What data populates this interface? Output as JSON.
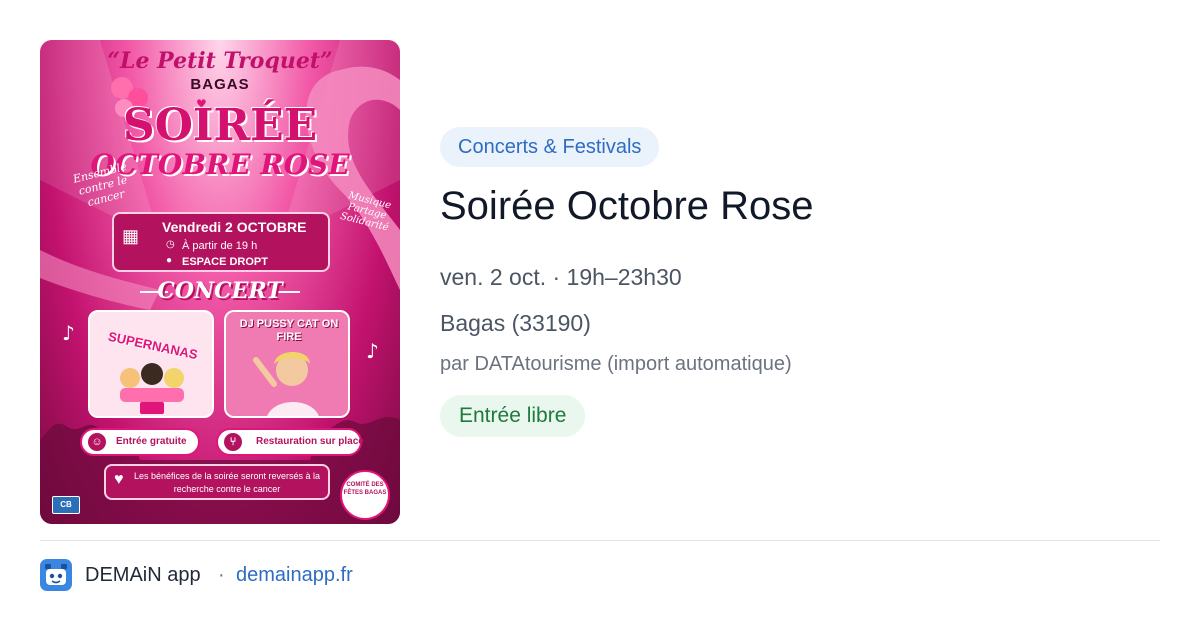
{
  "poster": {
    "brand": "“Le Petit Troquet”",
    "town": "BAGAS",
    "headline": "SOIRÉE",
    "subheadline": "OCTOBRE ROSE",
    "side_left": "Ensemble contre le cancer",
    "side_right": "Musique Partage Solidarité",
    "date": "Vendredi 2 OCTOBRE",
    "time": "À partir de 19 h",
    "venue": "ESPACE DROPT",
    "concert": "CONCERT",
    "act1": "SUPERNANAS",
    "act2": "DJ PUSSY CAT ON FIRE",
    "perk1": "Entrée gratuite",
    "perk2": "Restauration sur place",
    "benefit": "Les bénéfices de la soirée seront reversés à la recherche contre le cancer",
    "badge": "COMITÉ DES FÊTES BAGAS",
    "card_logo": "CB",
    "icons": [
      "calendar-icon",
      "clock-icon",
      "pin-icon",
      "people-icon",
      "fork-knife-icon",
      "heart-icon",
      "music-note-icon",
      "ribbon-icon"
    ]
  },
  "event": {
    "category": "Concerts & Festivals",
    "title": "Soirée Octobre Rose",
    "when": "ven. 2 oct. · 19h–23h30",
    "where": "Bagas (33190)",
    "author": "par DATAtourisme (import automatique)",
    "price": "Entrée libre"
  },
  "footer": {
    "app_name": "DEMAiN app",
    "separator": "·",
    "domain": "demainapp.fr",
    "logo_icon": "demain-app-logo-icon"
  },
  "colors": {
    "category_bg": "#eaf2fc",
    "category_text": "#2f6cc2",
    "price_bg": "#e9f7ee",
    "price_text": "#1f7a3d",
    "poster_pink": "#e0157a",
    "link": "#2f6cc2"
  }
}
